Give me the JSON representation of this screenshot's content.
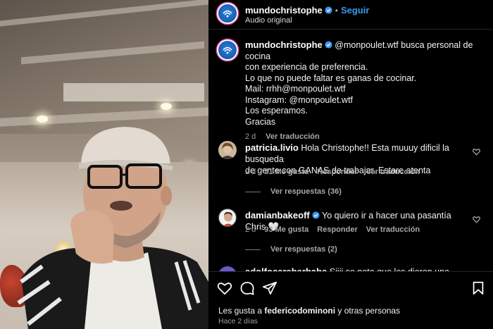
{
  "post": {
    "username": "mundochristophe",
    "follow_label": "Seguir",
    "audio_label": "Audio original",
    "avatar_icon": "brand-logo-icon",
    "verified_icon": "verified-badge-icon"
  },
  "caption": {
    "username": "mundochristophe",
    "lines": [
      "@monpoulet.wtf busca personal de cocina",
      "con experiencia de preferencia.",
      "Lo que no puede faltar es ganas de cocinar.",
      "Mail: rrhh@monpoulet.wtf",
      "Instagram: @monpoulet.wtf",
      "Los esperamos.",
      "Gracias"
    ],
    "time": "2 d",
    "translate_label": "Ver traducción"
  },
  "comments": [
    {
      "username": "patricia.livio",
      "text": "Hola Christophe!! Esta muuuy dificil la busqueda de gente con GANAS de trabajar. Estare atenta",
      "text_line1": "Hola Christophe!! Esta muuuy dificil la busqueda",
      "text_line2": "de gente con GANAS de trabajar. Estare atenta",
      "time": "2 d",
      "likes": "51 Me gusta",
      "reply_label": "Responder",
      "translate_label": "Ver traducción",
      "replies_label": "Ver respuestas (36)"
    },
    {
      "username": "damianbakeoff",
      "text": "Yo quiero ir a hacer una pasantía Chris 🤍",
      "time": "2 d",
      "likes": "93 Me gusta",
      "reply_label": "Responder",
      "translate_label": "Ver traducción",
      "replies_label": "Ver respuestas (2)"
    },
    {
      "username": "adolfocarabarbaba",
      "text": "Siiii se nota que les dieron una paliza!🤣"
    }
  ],
  "actions": {
    "like_icon": "heart-icon",
    "comment_icon": "comment-icon",
    "share_icon": "share-icon",
    "save_icon": "bookmark-icon"
  },
  "likes_summary": {
    "prefix": "Les gusta a ",
    "user": "federicodominoni",
    "suffix": " y otras personas"
  },
  "timeago": "Hace 2 días"
}
